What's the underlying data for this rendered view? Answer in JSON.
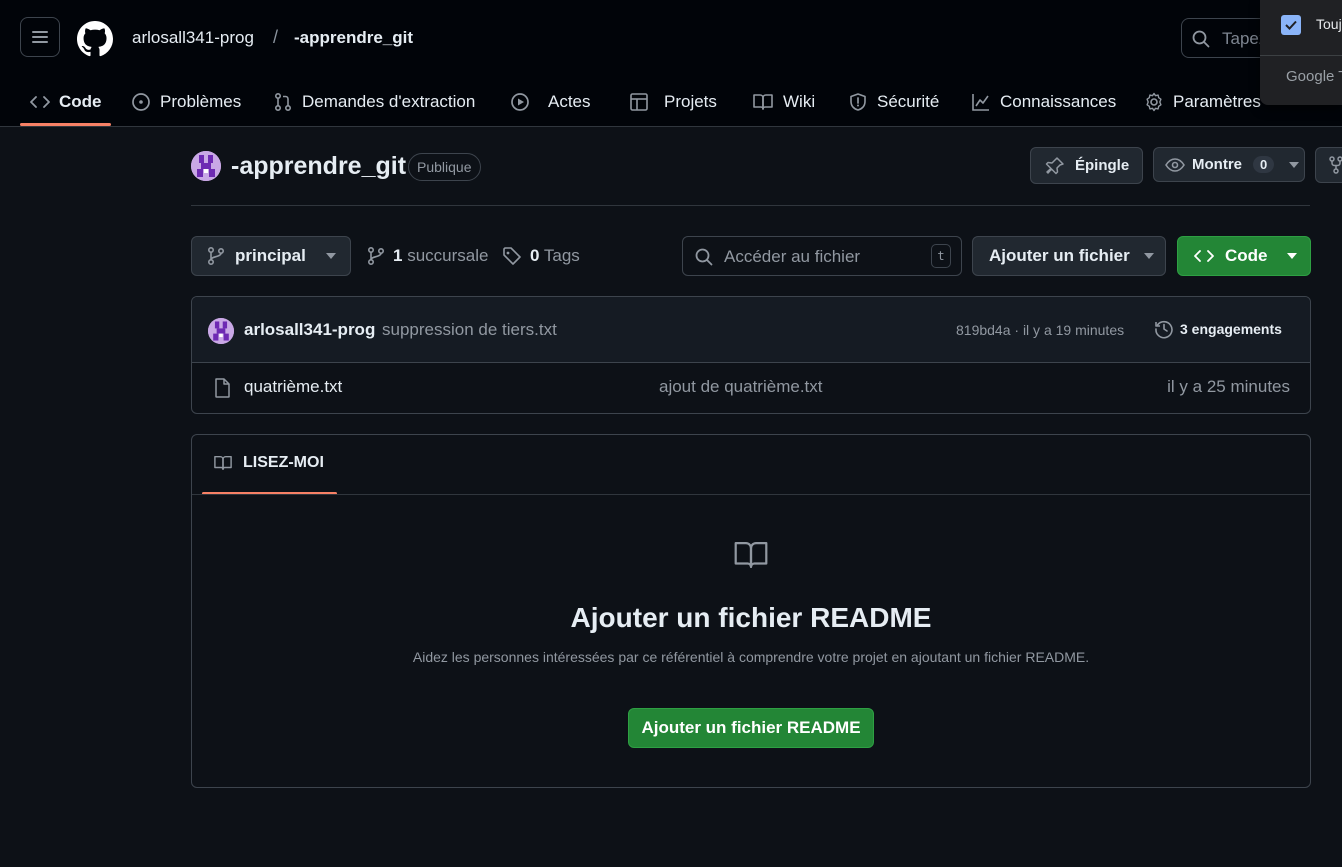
{
  "header": {
    "owner": "arlosall341-prog",
    "separator": "/",
    "repo": "-apprendre_git",
    "search_placeholder": "Tapez",
    "popup": {
      "checkbox_label": "Touj",
      "google_text": "Google T"
    }
  },
  "nav": {
    "items": [
      {
        "label": "Code",
        "icon": "code-icon",
        "active": true
      },
      {
        "label": "Problèmes",
        "icon": "issue-icon"
      },
      {
        "label": "Demandes d'extraction",
        "icon": "pull-request-icon"
      },
      {
        "label": "Actes",
        "icon": "play-icon"
      },
      {
        "label": "Projets",
        "icon": "table-icon"
      },
      {
        "label": "Wiki",
        "icon": "book-icon"
      },
      {
        "label": "Sécurité",
        "icon": "shield-icon"
      },
      {
        "label": "Connaissances",
        "icon": "graph-icon"
      },
      {
        "label": "Paramètres",
        "icon": "gear-icon"
      }
    ]
  },
  "repo": {
    "title": "-apprendre_git",
    "visibility": "Publique",
    "pin_label": "Épingle",
    "watch_label": "Montre",
    "watch_count": "0"
  },
  "toolbar": {
    "branch": "principal",
    "branches_count": "1",
    "branches_label": "succursale",
    "tags_count": "0",
    "tags_label": "Tags",
    "goto_placeholder": "Accéder au fichier",
    "goto_shortcut": "t",
    "add_file_label": "Ajouter un fichier",
    "code_label": "Code"
  },
  "commit": {
    "author": "arlosall341-prog",
    "message": "suppression de tiers.txt",
    "hash_time": "819bd4a · il y a 19 minutes",
    "commits_count": "3 engagements"
  },
  "files": [
    {
      "name": "quatrième.txt",
      "message": "ajout de quatrième.txt",
      "time": "il y a 25 minutes"
    }
  ],
  "readme": {
    "tab_label": "LISEZ-MOI",
    "heading": "Ajouter un fichier README",
    "description": "Aidez les personnes intéressées par ce référentiel à comprendre votre projet en ajoutant un fichier README.",
    "button_label": "Ajouter un fichier README"
  },
  "colors": {
    "background": "#0d1117",
    "header_bg": "#010409",
    "accent_underline": "#f78166",
    "primary_button": "#238636",
    "border": "#3d444d"
  }
}
